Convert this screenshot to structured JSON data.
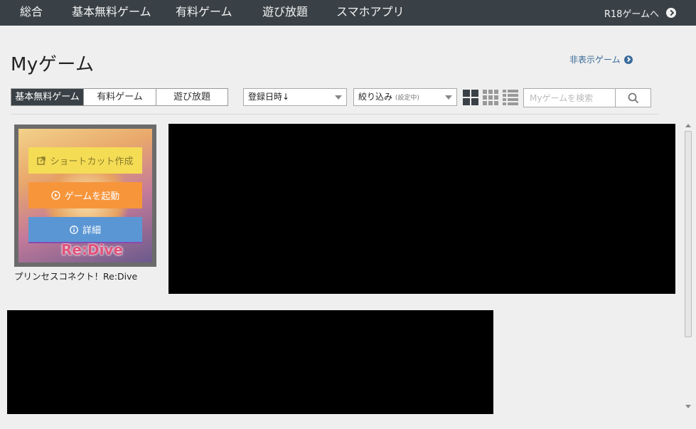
{
  "nav": {
    "items": [
      "総合",
      "基本無料ゲーム",
      "有料ゲーム",
      "遊び放題",
      "スマホアプリ"
    ],
    "r18": "R18ゲームへ"
  },
  "title": "Myゲーム",
  "hidden_games": "非表示ゲーム",
  "tabs": [
    {
      "label": "基本無料ゲーム",
      "active": true
    },
    {
      "label": "有料ゲーム",
      "active": false
    },
    {
      "label": "遊び放題",
      "active": false
    }
  ],
  "sort_select": {
    "value": "登録日時↓"
  },
  "filter_select": {
    "value": "絞り込み",
    "sub": "(設定中)"
  },
  "search": {
    "placeholder": "Myゲームを検索",
    "value": ""
  },
  "game_card": {
    "title": "プリンセスコネクト！Re:Dive",
    "art_text": "Re:Dive",
    "buttons": {
      "shortcut": "ショートカット作成",
      "launch": "ゲームを起動",
      "detail": "詳細"
    }
  }
}
